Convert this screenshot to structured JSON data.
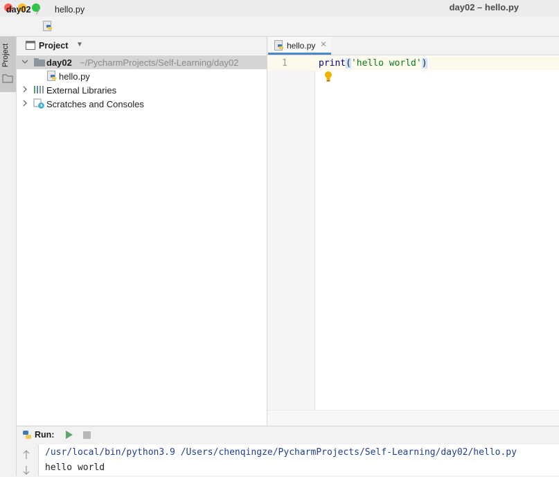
{
  "window": {
    "title": "day02 – hello.py",
    "colors": {
      "close": "#fe5f57",
      "minimize": "#febb2e",
      "zoom": "#28c840"
    }
  },
  "navbar": {
    "root": "day02",
    "file": "hello.py"
  },
  "toolstrip": {
    "project_label": "Project"
  },
  "project_panel": {
    "title": "Project",
    "root": {
      "name": "day02",
      "path": "~/PycharmProjects/Self-Learning/day02"
    },
    "file": "hello.py",
    "external": "External Libraries",
    "scratches": "Scratches and Consoles"
  },
  "editor": {
    "tab_label": "hello.py",
    "line_number": "1",
    "code": {
      "fn": "print",
      "open": "(",
      "str": "'hello world'",
      "close": ")"
    }
  },
  "run_panel": {
    "label": "Run:",
    "command": "/usr/local/bin/python3.9 /Users/chenqingze/PycharmProjects/Self-Learning/day02/hello.py",
    "output": "hello world"
  }
}
